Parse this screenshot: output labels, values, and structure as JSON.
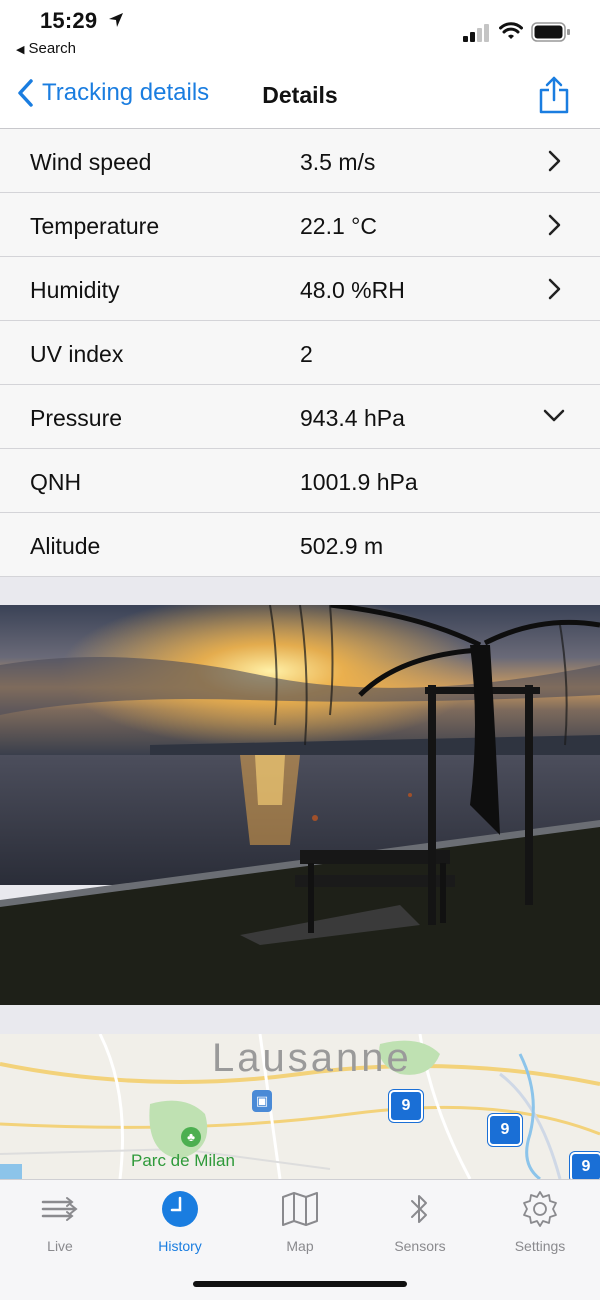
{
  "status_bar": {
    "time": "15:29",
    "back_app": "Search"
  },
  "nav": {
    "back_label": "Tracking details",
    "title": "Details"
  },
  "rows": [
    {
      "label": "Wind speed",
      "value": "3.5 m/s",
      "accessory": "chevron-right"
    },
    {
      "label": "Temperature",
      "value": "22.1 °C",
      "accessory": "chevron-right"
    },
    {
      "label": "Humidity",
      "value": "48.0 %RH",
      "accessory": "chevron-right"
    },
    {
      "label": "UV index",
      "value": "2",
      "accessory": "none"
    },
    {
      "label": "Pressure",
      "value": "943.4 hPa",
      "accessory": "chevron-down"
    },
    {
      "label": "QNH",
      "value": "1001.9 hPa",
      "accessory": "none"
    },
    {
      "label": "Alitude",
      "value": "502.9 m",
      "accessory": "none"
    }
  ],
  "map": {
    "city": "Lausanne",
    "park": "Parc de Milan",
    "route_badges": [
      "9",
      "9",
      "9"
    ]
  },
  "tabs": [
    {
      "label": "Live",
      "icon": "wind-icon",
      "active": false
    },
    {
      "label": "History",
      "icon": "clock-icon",
      "active": true
    },
    {
      "label": "Map",
      "icon": "map-icon",
      "active": false
    },
    {
      "label": "Sensors",
      "icon": "bluetooth-icon",
      "active": false
    },
    {
      "label": "Settings",
      "icon": "gear-icon",
      "active": false
    }
  ],
  "colors": {
    "accent": "#1a7de0",
    "inactive_tab": "#8a8a8e"
  }
}
